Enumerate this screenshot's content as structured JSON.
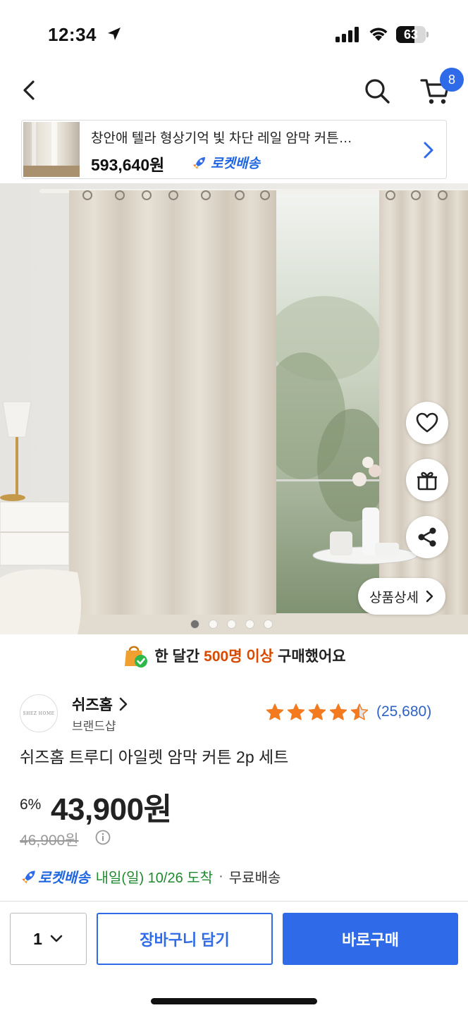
{
  "status_bar": {
    "time": "12:34",
    "battery": "63",
    "battery_level": 0.63
  },
  "nav": {
    "cart_count": "8"
  },
  "recommended": {
    "title": "창안애 텔라 형상기억 빛 차단 레일 암막 커튼…",
    "price": "593,640원",
    "rocket_label": "로켓배송"
  },
  "gallery": {
    "detail_button": "상품상세",
    "total_images": 5,
    "active_index": 0
  },
  "sales_banner": {
    "prefix": "한 달간",
    "highlight": "500명 이상",
    "suffix": "구매했어요"
  },
  "seller": {
    "name": "쉬즈홈",
    "logo_text": "SHEZ HOME",
    "subtitle": "브랜드샵"
  },
  "rating": {
    "stars": 4.5,
    "count": "(25,680)"
  },
  "product": {
    "name": "쉬즈홈 트루디 아일렛 암막 커튼 2p 세트",
    "discount": "6%",
    "price": "43,900원",
    "original_price": "46,900원"
  },
  "delivery": {
    "rocket_label": "로켓배송",
    "arrival": "내일(일) 10/26 도착",
    "separator": "·",
    "shipping": "무료배송"
  },
  "bottom_bar": {
    "quantity": "1",
    "add_to_cart": "장바구니 담기",
    "buy_now": "바로구매"
  },
  "colors": {
    "accent": "#2f6be8",
    "highlight": "#d84a00",
    "rating_link": "#2f62c8",
    "star": "#f47a20",
    "delivery": "#1f8a2e"
  },
  "icons": [
    "location-arrow-icon",
    "signal-icon",
    "wifi-icon",
    "back-arrow-icon",
    "search-icon",
    "cart-icon",
    "chevron-right-icon",
    "rocket-icon",
    "heart-icon",
    "gift-icon",
    "share-icon",
    "shopping-bag-icon",
    "star-icon",
    "info-icon",
    "chevron-down-icon"
  ]
}
